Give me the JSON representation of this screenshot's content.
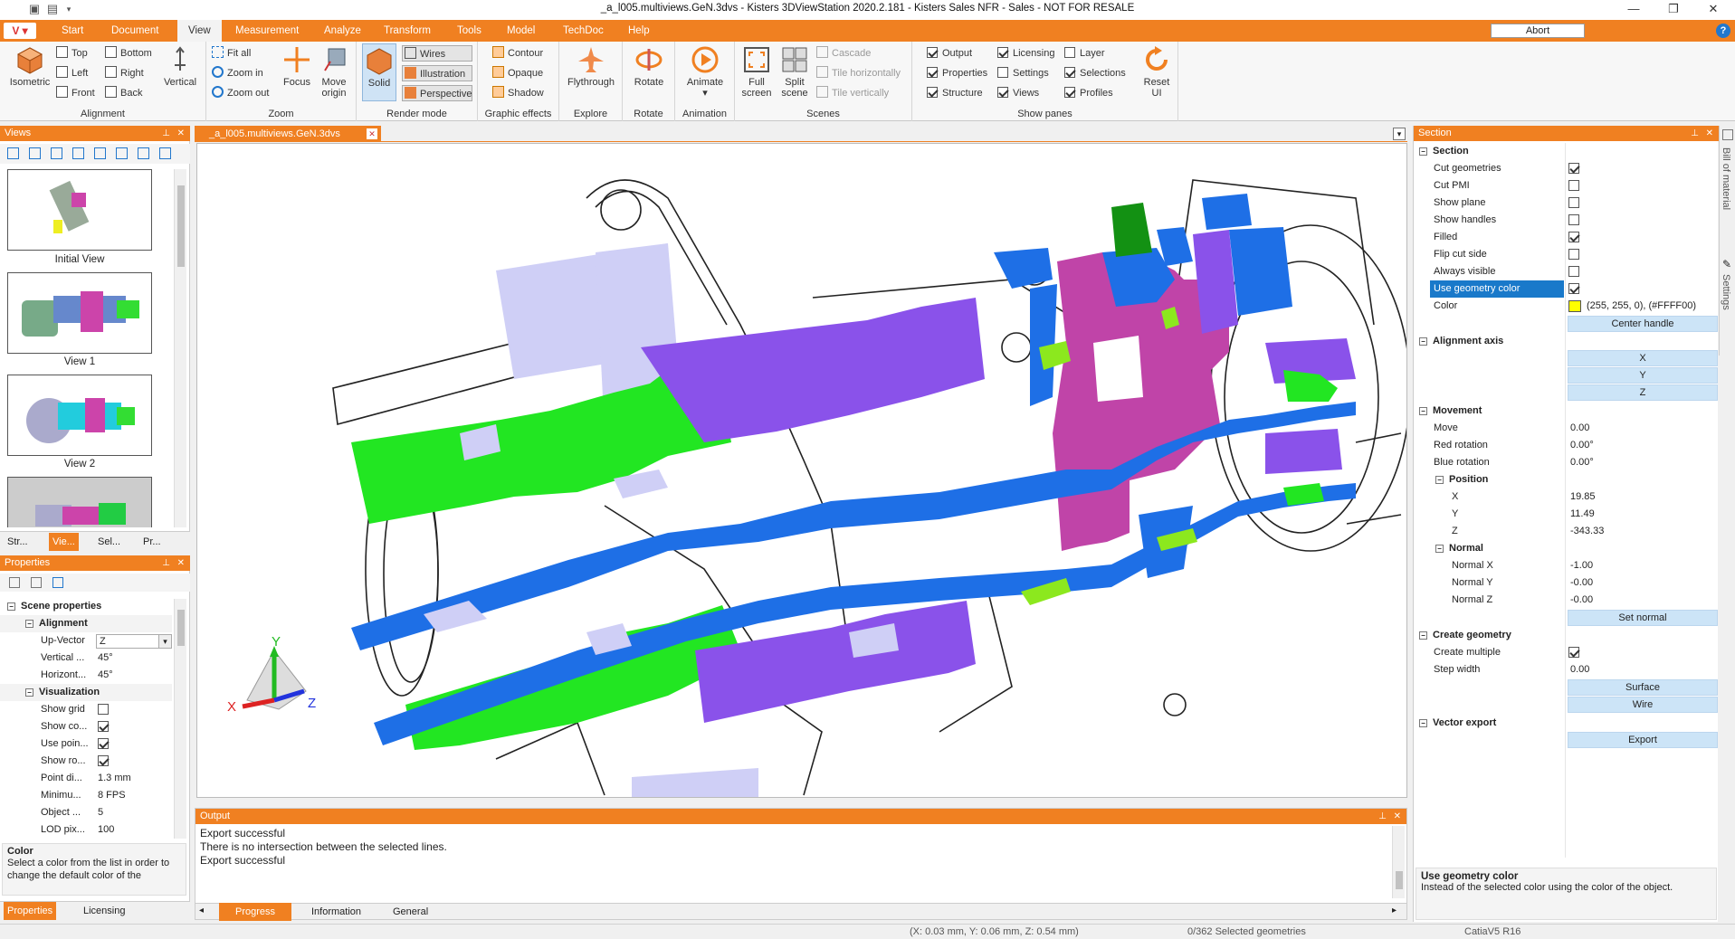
{
  "window": {
    "title": "_a_l005.multiviews.GeN.3dvs - Kisters 3DViewStation 2020.2.181 - Kisters Sales NFR - Sales - NOT FOR RESALE"
  },
  "menu": {
    "app_label": "V",
    "tabs": [
      "Start",
      "Document",
      "View",
      "Measurement",
      "Analyze",
      "Transform",
      "Tools",
      "Model",
      "TechDoc",
      "Help"
    ],
    "abort": "Abort"
  },
  "ribbon": {
    "alignment": {
      "label": "Alignment",
      "isometric": "Isometric",
      "top": "Top",
      "left": "Left",
      "front": "Front",
      "bottom": "Bottom",
      "right": "Right",
      "back": "Back",
      "vertical": "Vertical"
    },
    "zoom": {
      "label": "Zoom",
      "fit_all": "Fit all",
      "zoom_in": "Zoom in",
      "zoom_out": "Zoom out",
      "focus": "Focus",
      "move_origin_1": "Move",
      "move_origin_2": "origin"
    },
    "render": {
      "label": "Render mode",
      "solid": "Solid",
      "wires": "Wires",
      "illustration": "Illustration",
      "perspective": "Perspective"
    },
    "effects": {
      "label": "Graphic effects",
      "contour": "Contour",
      "opaque": "Opaque",
      "shadow": "Shadow"
    },
    "explore": {
      "label": "Explore",
      "flythrough": "Flythrough"
    },
    "rotate": {
      "label": "Rotate",
      "rotate": "Rotate"
    },
    "animation": {
      "label": "Animation",
      "animate": "Animate"
    },
    "scenes": {
      "label": "Scenes",
      "full_1": "Full",
      "full_2": "screen",
      "split_1": "Split",
      "split_2": "scene",
      "cascade": "Cascade",
      "tile_h": "Tile horizontally",
      "tile_v": "Tile vertically"
    },
    "panes": {
      "label": "Show panes",
      "items": [
        {
          "label": "Output",
          "checked": true
        },
        {
          "label": "Properties",
          "checked": true
        },
        {
          "label": "Structure",
          "checked": true
        },
        {
          "label": "Licensing",
          "checked": true
        },
        {
          "label": "Settings",
          "checked": false
        },
        {
          "label": "Views",
          "checked": true
        },
        {
          "label": "Layer",
          "checked": false
        },
        {
          "label": "Selections",
          "checked": true
        },
        {
          "label": "Profiles",
          "checked": true
        }
      ],
      "reset_1": "Reset",
      "reset_2": "UI"
    }
  },
  "views_panel": {
    "title": "Views",
    "thumbs": [
      {
        "label": "Initial View"
      },
      {
        "label": "View 1"
      },
      {
        "label": "View 2"
      }
    ],
    "tabs": [
      "Str...",
      "Vie...",
      "Sel...",
      "Pr..."
    ]
  },
  "properties_panel": {
    "title": "Properties",
    "scene": "Scene properties",
    "alignment": "Alignment",
    "upvector_label": "Up-Vector",
    "upvector_value": "Z",
    "vertical_label": "Vertical ...",
    "vertical_value": "45°",
    "horizontal_label": "Horizont...",
    "horizontal_value": "45°",
    "visualization": "Visualization",
    "show_grid": "Show grid",
    "show_co": "Show co...",
    "use_poin": "Use poin...",
    "show_ro": "Show ro...",
    "point_di_label": "Point di...",
    "point_di_value": "1.3 mm",
    "minimu_label": "Minimu...",
    "minimu_value": "8 FPS",
    "object_label": "Object ...",
    "object_value": "5",
    "lod_label": "LOD pix...",
    "lod_value": "100",
    "help_title": "Color",
    "help_text": "Select a color from the list in order to change the default color of the",
    "tabs": [
      "Properties",
      "Licensing"
    ]
  },
  "document_tab": {
    "label": "_a_l005.multiviews.GeN.3dvs"
  },
  "viewport": {
    "axis_x": "X",
    "axis_y": "Y",
    "axis_z": "Z"
  },
  "output_panel": {
    "title": "Output",
    "lines": [
      "Export successful",
      "There is no intersection between the selected lines.",
      "Export successful"
    ],
    "tabs": [
      "Progress",
      "Information",
      "General"
    ]
  },
  "section_panel": {
    "title": "Section",
    "section_header": "Section",
    "cut_geometries": "Cut geometries",
    "cut_pmi": "Cut PMI",
    "show_plane": "Show plane",
    "show_handles": "Show handles",
    "filled": "Filled",
    "flip_cut_side": "Flip cut side",
    "always_visible": "Always visible",
    "use_geometry_color": "Use geometry color",
    "color_label": "Color",
    "color_value": "(255, 255, 0), (#FFFF00)",
    "color_hex": "#FFFF00",
    "center_handle": "Center handle",
    "alignment_axis": "Alignment axis",
    "x": "X",
    "y": "Y",
    "z": "Z",
    "movement": "Movement",
    "move_label": "Move",
    "move_value": "0.00",
    "red_rot_label": "Red rotation",
    "red_rot_value": "0.00°",
    "blue_rot_label": "Blue rotation",
    "blue_rot_value": "0.00°",
    "position": "Position",
    "pos_x_label": "X",
    "pos_x_value": "19.85",
    "pos_y_label": "Y",
    "pos_y_value": "11.49",
    "pos_z_label": "Z",
    "pos_z_value": "-343.33",
    "normal": "Normal",
    "nx_label": "Normal X",
    "nx_value": "-1.00",
    "ny_label": "Normal Y",
    "ny_value": "-0.00",
    "nz_label": "Normal Z",
    "nz_value": "-0.00",
    "set_normal": "Set normal",
    "create_geometry": "Create geometry",
    "create_multiple": "Create multiple",
    "step_width_label": "Step width",
    "step_width_value": "0.00",
    "surface": "Surface",
    "wire": "Wire",
    "vector_export": "Vector export",
    "export": "Export",
    "help_title": "Use geometry color",
    "help_text": "Instead of the selected color using the color of the object."
  },
  "side_tabs": [
    "Bill of material",
    "Settings"
  ],
  "statusbar": {
    "coords": "(X: 0.03 mm, Y: 0.06 mm, Z: 0.54 mm)",
    "selected": "0/362 Selected geometries",
    "format": "CatiaV5 R16"
  },
  "colors": {
    "accent": "#f08021",
    "blue_part": "#1e6fe6",
    "green_part": "#22e622",
    "magenta_part": "#c044a8",
    "violet_part": "#8a52ea",
    "lavender_part": "#cfcff6"
  }
}
